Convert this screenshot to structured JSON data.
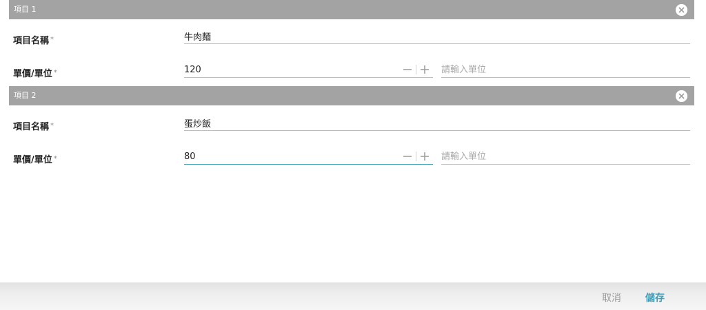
{
  "items": [
    {
      "header": "項目 1",
      "name_label": "項目名稱",
      "name_value": "牛肉麵",
      "price_label": "單價/單位",
      "price_value": "120",
      "unit_placeholder": "請輸入單位",
      "required_mark": "*"
    },
    {
      "header": "項目 2",
      "name_label": "項目名稱",
      "name_value": "蛋炒飯",
      "price_label": "單價/單位",
      "price_value": "80",
      "unit_placeholder": "請輸入單位",
      "required_mark": "*"
    }
  ],
  "footer": {
    "cancel_label": "取消",
    "save_label": "儲存"
  },
  "colors": {
    "accent": "#3c9db9",
    "header_bg": "#a3a3a3"
  }
}
